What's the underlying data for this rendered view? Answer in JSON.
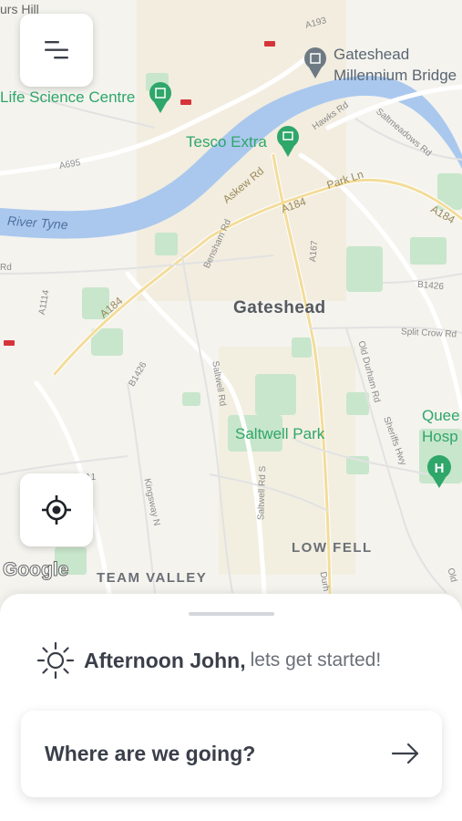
{
  "map": {
    "labels": {
      "hill": "urs Hill",
      "gateshead_bridge_1": "Gateshead",
      "gateshead_bridge_2": "Millennium Bridge",
      "life_science": "Life Science Centre",
      "tesco": "Tesco Extra",
      "river": "River Tyne",
      "gateshead": "Gateshead",
      "saltwell_park": "Saltwell Park",
      "low_fell": "LOW FELL",
      "team_valley": "TEAM VALLEY",
      "queen_1": "Quee",
      "queen_2": "Hosp",
      "a193": "A193",
      "a695": "A695",
      "a184a": "A184",
      "a184b": "A184",
      "a184c": "A184",
      "park_ln": "Park Ln",
      "askew_rd": "Askew Rd",
      "hawks_rd": "Hawks Rd",
      "saltmeadows": "Saltmeadows Rd",
      "bensham": "Bensham Rd",
      "a167": "A167",
      "b1426a": "B1426",
      "b1426b": "B1426",
      "a1114": "A1114",
      "split_crow": "Split Crow Rd",
      "old_durham": "Old Durham Rd",
      "sheriffs": "Sheriffs Hwy",
      "saltwell_rd": "Saltwell Rd",
      "saltwell_rd_s": "Saltwell Rd S",
      "kingsway": "Kingsway N",
      "rd": "Rd",
      "durham": "Durh",
      "old": "Old",
      "a1": "A1"
    },
    "attribution": "Google"
  },
  "controls": {
    "menu_icon": "menu-icon",
    "locate_icon": "crosshair-icon"
  },
  "sheet": {
    "greeting_name": "Afternoon John",
    "greeting_comma": ",",
    "greeting_rest": "lets get started!",
    "search_placeholder": "Where are we going?"
  },
  "colors": {
    "water": "#aac8ee",
    "park": "#c8e6cb",
    "poi": "#2fa66a",
    "text_dark": "#3a3f4a"
  }
}
